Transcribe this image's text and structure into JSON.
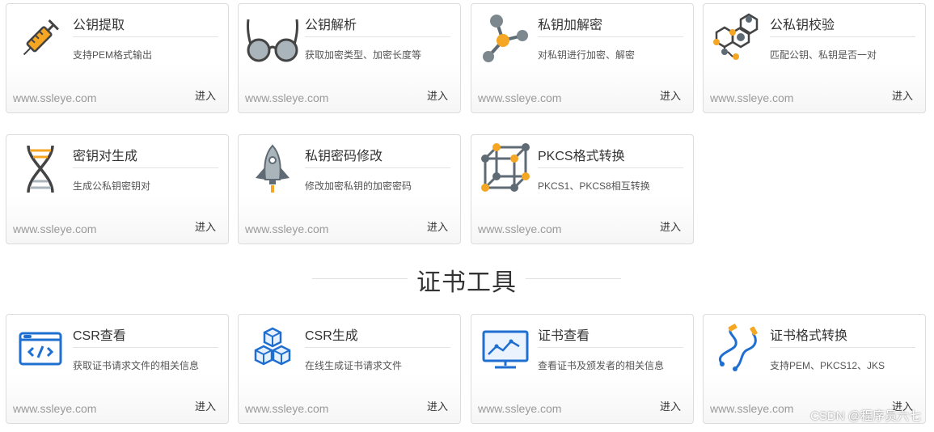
{
  "key_tools": [
    {
      "icon": "syringe-icon",
      "title": "公钥提取",
      "desc": "支持PEM格式输出",
      "site": "www.ssleye.com",
      "enter": "进入"
    },
    {
      "icon": "glasses-icon",
      "title": "公钥解析",
      "desc": "获取加密类型、加密长度等",
      "site": "www.ssleye.com",
      "enter": "进入"
    },
    {
      "icon": "molecule-icon",
      "title": "私钥加解密",
      "desc": "对私钥进行加密、解密",
      "site": "www.ssleye.com",
      "enter": "进入"
    },
    {
      "icon": "hexagon-network-icon",
      "title": "公私钥校验",
      "desc": "匹配公钥、私钥是否一对",
      "site": "www.ssleye.com",
      "enter": "进入"
    },
    {
      "icon": "dna-helix-icon",
      "title": "密钥对生成",
      "desc": "生成公私钥密钥对",
      "site": "www.ssleye.com",
      "enter": "进入"
    },
    {
      "icon": "rocket-icon",
      "title": "私钥密码修改",
      "desc": "修改加密私钥的加密密码",
      "site": "www.ssleye.com",
      "enter": "进入"
    },
    {
      "icon": "cube-lattice-icon",
      "title": "PKCS格式转换",
      "desc": "PKCS1、PKCS8相互转换",
      "site": "www.ssleye.com",
      "enter": "进入"
    }
  ],
  "section": {
    "title": "证书工具"
  },
  "cert_tools": [
    {
      "icon": "code-window-icon",
      "title": "CSR查看",
      "desc": "获取证书请求文件的相关信息",
      "site": "www.ssleye.com",
      "enter": "进入"
    },
    {
      "icon": "cubes-icon",
      "title": "CSR生成",
      "desc": "在线生成证书请求文件",
      "site": "www.ssleye.com",
      "enter": "进入"
    },
    {
      "icon": "monitor-chart-icon",
      "title": "证书查看",
      "desc": "查看证书及颁发者的相关信息",
      "site": "www.ssleye.com",
      "enter": "进入"
    },
    {
      "icon": "cable-icon",
      "title": "证书格式转换",
      "desc": "支持PEM、PKCS12、JKS",
      "site": "www.ssleye.com",
      "enter": "进入"
    }
  ],
  "watermark": "CSDN @程序员六七",
  "colors": {
    "accent_orange": "#f5a623",
    "icon_gray": "#5f6b74",
    "icon_blue": "#1f6fd0",
    "border": "#dcdcdc"
  }
}
